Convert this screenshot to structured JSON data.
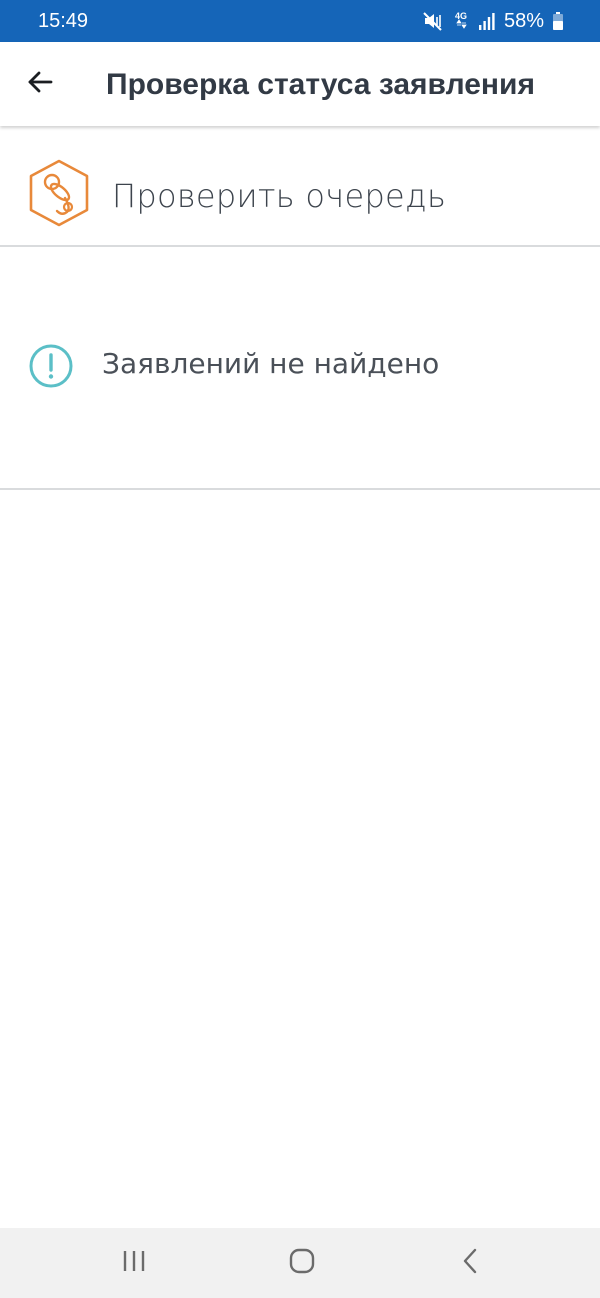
{
  "status_bar": {
    "time": "15:49",
    "battery": "58%",
    "network": "4G",
    "icons": [
      "mute-vibrate-icon",
      "network-4g-icon",
      "signal-icon",
      "battery-icon"
    ],
    "background": "#1565b8"
  },
  "app_bar": {
    "title": "Проверка статуса заявления",
    "back_icon": "arrow-left-icon"
  },
  "check_queue": {
    "label": "Проверить очередь",
    "icon": "pacifier-icon",
    "icon_color": "#e8893a"
  },
  "empty_state": {
    "message": "Заявлений не найдено",
    "icon": "info-exclamation-icon",
    "icon_color": "#5bbfc7"
  },
  "nav_bar": {
    "items": [
      "recent-apps-icon",
      "home-icon",
      "back-icon"
    ]
  }
}
